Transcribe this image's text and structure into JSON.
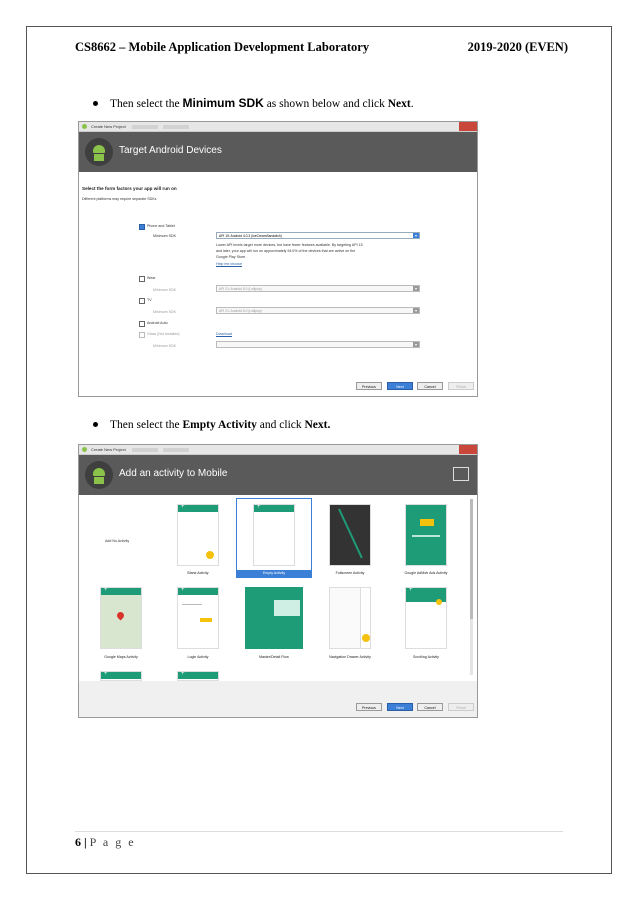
{
  "header": {
    "course": "CS8662 – Mobile Application Development Laboratory",
    "year": "2019-2020 (EVEN)"
  },
  "step1": {
    "pre": "Then select the ",
    "bold": "Minimum SDK",
    "mid": " as shown below and click ",
    "bold2": "Next",
    "post": "."
  },
  "step2": {
    "pre": "Then select the ",
    "bold": "Empty Activity",
    "mid": " and click ",
    "bold2": "Next."
  },
  "shot1": {
    "window_title": "Create New Project",
    "banner_title": "Target Android Devices",
    "heading": "Select the form factors your app will run on",
    "subheading": "Different platforms may require separate SDKs",
    "phone_label": "Phone and Tablet",
    "min_sdk_label": "Minimum SDK",
    "phone_sdk": "API 15: Android 4.0.3 (IceCreamSandwich)",
    "info_line1": "Lower API levels target more devices, but have fewer features available. By targeting API 15",
    "info_line2": "and later, your app will run on approximately 94.0% of the devices that are active on the",
    "info_line3": "Google Play Store.",
    "help_link": "Help me choose",
    "wear_label": "Wear",
    "wear_sdk": "API 21: Android 5.0 (Lollipop)",
    "tv_label": "TV",
    "tv_sdk": "API 21: Android 5.0 (Lollipop)",
    "auto_label": "Android Auto",
    "glass_label": "Glass (Not Installed)",
    "download_link": "Download",
    "btn_previous": "Previous",
    "btn_next": "Next",
    "btn_cancel": "Cancel",
    "btn_finish": "Finish"
  },
  "shot2": {
    "window_title": "Create New Project",
    "banner_title": "Add an activity to Mobile",
    "activities_row1": [
      "Add No Activity",
      "Blank Activity",
      "Empty Activity",
      "Fullscreen Activity",
      "Google AdMob Ads Activity"
    ],
    "activities_row2": [
      "Google Maps Activity",
      "Login Activity",
      "Master/Detail Flow",
      "Navigation Drawer Activity",
      "Scrolling Activity"
    ],
    "btn_previous": "Previous",
    "btn_next": "Next",
    "btn_cancel": "Cancel",
    "btn_finish": "Finish"
  },
  "footer": {
    "page_num": "6",
    "sep": " | ",
    "page_word": "P a g e"
  }
}
